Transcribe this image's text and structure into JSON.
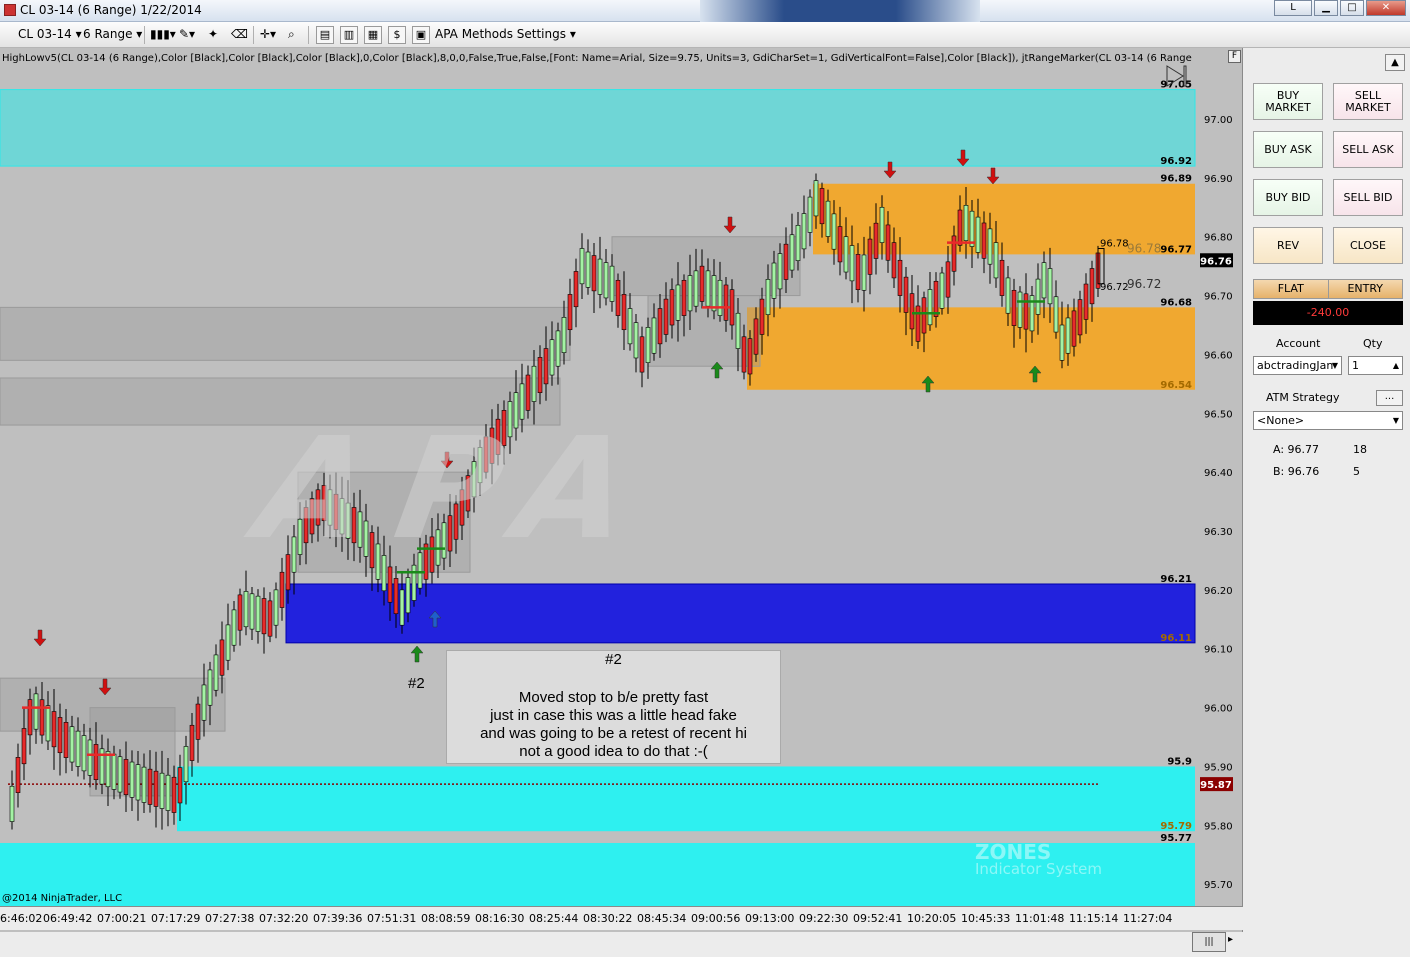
{
  "window": {
    "title": "CL 03-14 (6 Range)  1/22/2014",
    "minimize_label": "L",
    "restore_label": "□",
    "max_label": "▭",
    "close_label": "✕"
  },
  "toolbar": {
    "instrument": "CL 03-14",
    "period": "6 Range",
    "settings_label": "APA Methods Settings"
  },
  "chart": {
    "indicator_text": "HighLowv5(CL 03-14 (6 Range),Color [Black],Color [Black],Color [Black],0,Color [Black],8,0,0,False,True,False,[Font: Name=Arial, Size=9.75, Units=3, GdiCharSet=1, GdiVerticalFont=False],Color [Black]), jtRangeMarker(CL 03-14 (6 Range",
    "f_button": "F",
    "copyright": "@2014 NinjaTrader, LLC",
    "watermark": "APA",
    "zones_brand": "ZONES",
    "zones_sub": "Indicator System",
    "note_title": "#2",
    "note_lines": [
      "Moved stop to b/e pretty fast",
      "just in case this was a little head fake",
      "and was going to be a retest of recent hi",
      "not a good idea to do that :-("
    ],
    "label_2": "#2",
    "price_ticks": [
      "97.00",
      "96.90",
      "96.80",
      "96.70",
      "96.60",
      "96.50",
      "96.40",
      "96.30",
      "96.20",
      "96.10",
      "96.00",
      "95.90",
      "95.80",
      "95.70"
    ],
    "zone_labels": [
      "97.05",
      "96.92",
      "96.89",
      "96.77",
      "96.68",
      "96.54",
      "96.21",
      "96.11",
      "95.9",
      "95.79",
      "95.77"
    ],
    "current_price": "96.76",
    "stop_price": "95.87",
    "range_high": "96.78",
    "range_low": "96.72",
    "gray_label_a": "96.78",
    "gray_label_b": "96.72",
    "time_labels": [
      "6:46:02",
      "06:49:42",
      "07:00:21",
      "07:17:29",
      "07:27:38",
      "07:32:20",
      "07:39:36",
      "07:51:31",
      "08:08:59",
      "08:16:30",
      "08:25:44",
      "08:30:22",
      "08:45:34",
      "09:00:56",
      "09:13:00",
      "09:22:30",
      "09:52:41",
      "10:20:05",
      "10:45:33",
      "11:01:48",
      "11:15:14",
      "11:27:04"
    ],
    "colors": {
      "background": "#bfbfbf",
      "cyan_top": "#6fd6d6",
      "orange_zone": "#f0a830",
      "blue_zone": "#2222dd",
      "cyan_bottom": "#2ef0f0",
      "up_candle": "#a4f2a4",
      "down_candle": "#e82a2a"
    }
  },
  "panel": {
    "buttons": [
      "BUY\nMARKET",
      "SELL\nMARKET",
      "BUY ASK",
      "SELL ASK",
      "BUY BID",
      "SELL BID",
      "REV",
      "CLOSE"
    ],
    "position_label": "FLAT",
    "entry_label": "ENTRY",
    "pnl": "-240.00",
    "account_label": "Account",
    "qty_label": "Qty",
    "account_value": "abctradingJan",
    "qty_value": "1",
    "atm_label": "ATM Strategy",
    "atm_ellipsis": "...",
    "atm_value": "<None>",
    "ask_label": "A: 96.77",
    "ask_size": "18",
    "bid_label": "B: 96.76",
    "bid_size": "5",
    "scroll_up": "▲"
  }
}
